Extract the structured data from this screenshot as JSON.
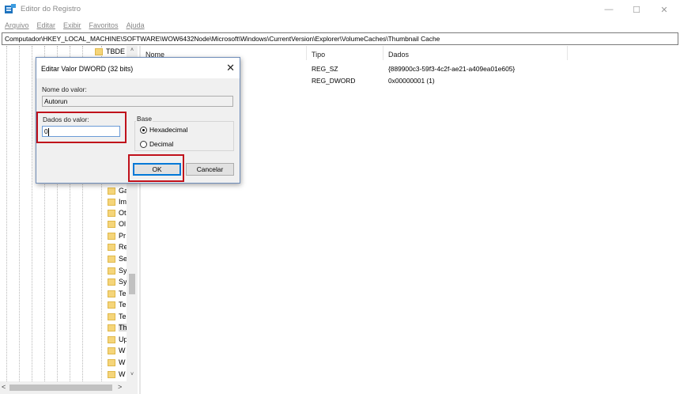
{
  "window": {
    "title": "Editor do Registro",
    "controls": {
      "minimize": "—",
      "maximize": "☐",
      "close": "✕"
    },
    "app_icon": "registry-editor-icon"
  },
  "menu": {
    "items": [
      "Arquivo",
      "Editar",
      "Exibir",
      "Favoritos",
      "Ajuda"
    ]
  },
  "address": {
    "path": "Computador\\HKEY_LOCAL_MACHINE\\SOFTWARE\\WOW6432Node\\Microsoft\\Windows\\CurrentVersion\\Explorer\\VolumeCaches\\Thumbnail Cache"
  },
  "tree": {
    "top_item": "TBDE",
    "items": [
      "Ga",
      "Im",
      "Ot",
      "Ol",
      "Pr",
      "Re",
      "Se",
      "Sy",
      "Sy",
      "Te",
      "Te",
      "Te",
      "Th",
      "Up",
      "W",
      "W",
      "W"
    ],
    "selected_index": 12,
    "scroll_up": "˄",
    "scroll_down": "˅",
    "hscroll_left": "<",
    "hscroll_right": ">"
  },
  "list": {
    "headers": {
      "name": "Nome",
      "type": "Tipo",
      "data": "Dados"
    },
    "rows": [
      {
        "type": "REG_SZ",
        "data": "{889900c3-59f3-4c2f-ae21-a409ea01e605}"
      },
      {
        "type": "REG_DWORD",
        "data": "0x00000001 (1)"
      }
    ]
  },
  "dialog": {
    "title": "Editar Valor DWORD (32 bits)",
    "close": "✕",
    "name_label": "Nome do valor:",
    "name_value": "Autorun",
    "data_label": "Dados do valor:",
    "data_value": "0",
    "base_label": "Base",
    "base_options": [
      {
        "label": "Hexadecimal",
        "checked": true
      },
      {
        "label": "Decimal",
        "checked": false
      }
    ],
    "ok": "OK",
    "cancel": "Cancelar"
  },
  "colors": {
    "highlight": "#c0111b",
    "focus": "#0078d7",
    "folder": "#f5d57a"
  }
}
